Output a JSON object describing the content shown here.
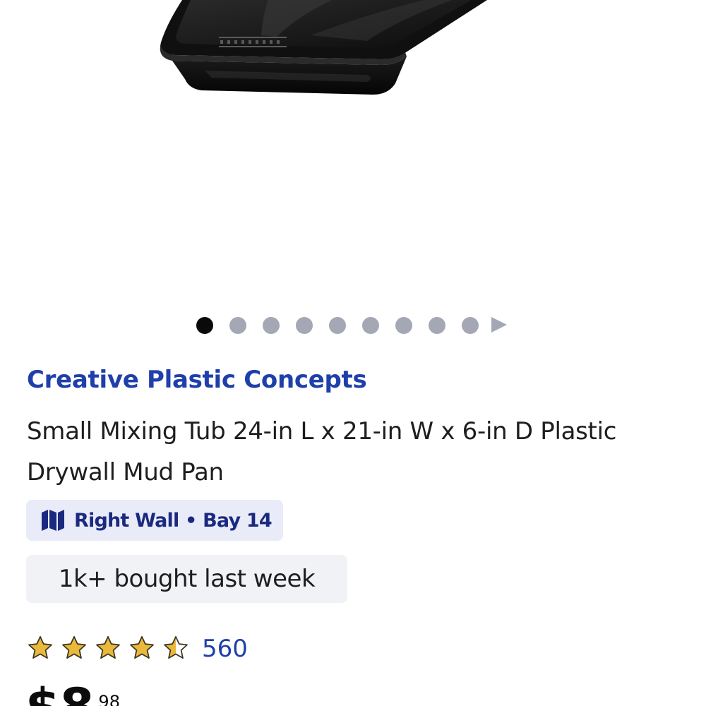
{
  "product": {
    "brand": "Creative Plastic Concepts",
    "title": "Small Mixing Tub 24-in L x 21-in W x 6-in D Plastic Drywall Mud Pan",
    "location": "Right Wall • Bay 14",
    "bought_badge": "1k+ bought last week",
    "rating": 4.5,
    "review_count": "560",
    "price_dollars": "$8",
    "price_cents": "98"
  },
  "carousel": {
    "image_count": 9,
    "active_index": 0
  },
  "icons": {
    "location": "map-icon",
    "carousel_next": "play-triangle-icon",
    "rating": "star-icon"
  },
  "colors": {
    "brand_link": "#1f3faa",
    "location_chip_bg": "#e9ecf8",
    "location_text": "#1b2a80",
    "badge_bg": "#f1f2f6",
    "star_fill": "#e8b93a",
    "dot_inactive": "#a3a8b4",
    "dot_active": "#0a0a0a"
  }
}
